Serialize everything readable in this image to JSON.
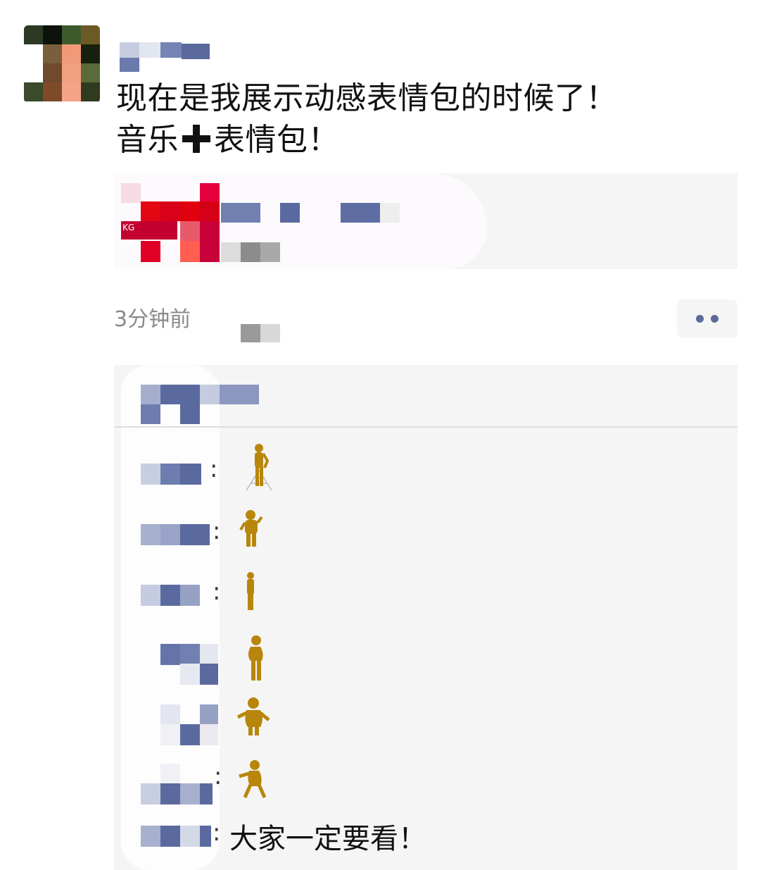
{
  "post": {
    "author_name": "",
    "text_line1": "现在是我展示动感表情包的时候了！",
    "text_line2_before": "音乐",
    "text_line2_after": "表情包！",
    "link_card": {
      "title": "",
      "source": ""
    },
    "time": "3分钟前",
    "more_button": "••"
  },
  "comments": [
    {
      "author": "",
      "separator": ":",
      "content": "",
      "sticker": "dancer-sticker-1"
    },
    {
      "author": "",
      "separator": ":",
      "content": "",
      "sticker": "dancer-sticker-2"
    },
    {
      "author": "",
      "separator": ":",
      "content": "",
      "sticker": "dancer-sticker-3"
    },
    {
      "author": "",
      "separator": "",
      "content": "",
      "sticker": "dancer-sticker-4"
    },
    {
      "author": "",
      "separator": "",
      "content": "",
      "sticker": "dancer-sticker-5"
    },
    {
      "author": "",
      "separator": ":",
      "content": "",
      "sticker": "dancer-sticker-6"
    },
    {
      "author": "",
      "separator": ":",
      "content": "大家一定要看！",
      "sticker": ""
    }
  ],
  "colors": {
    "accent_name": "#5b6a99",
    "link_card_bg": "#f5f5f5",
    "sticker": "#b8860b"
  },
  "icons": {
    "plus": "heavy-plus-icon",
    "more": "more-dots-icon"
  }
}
